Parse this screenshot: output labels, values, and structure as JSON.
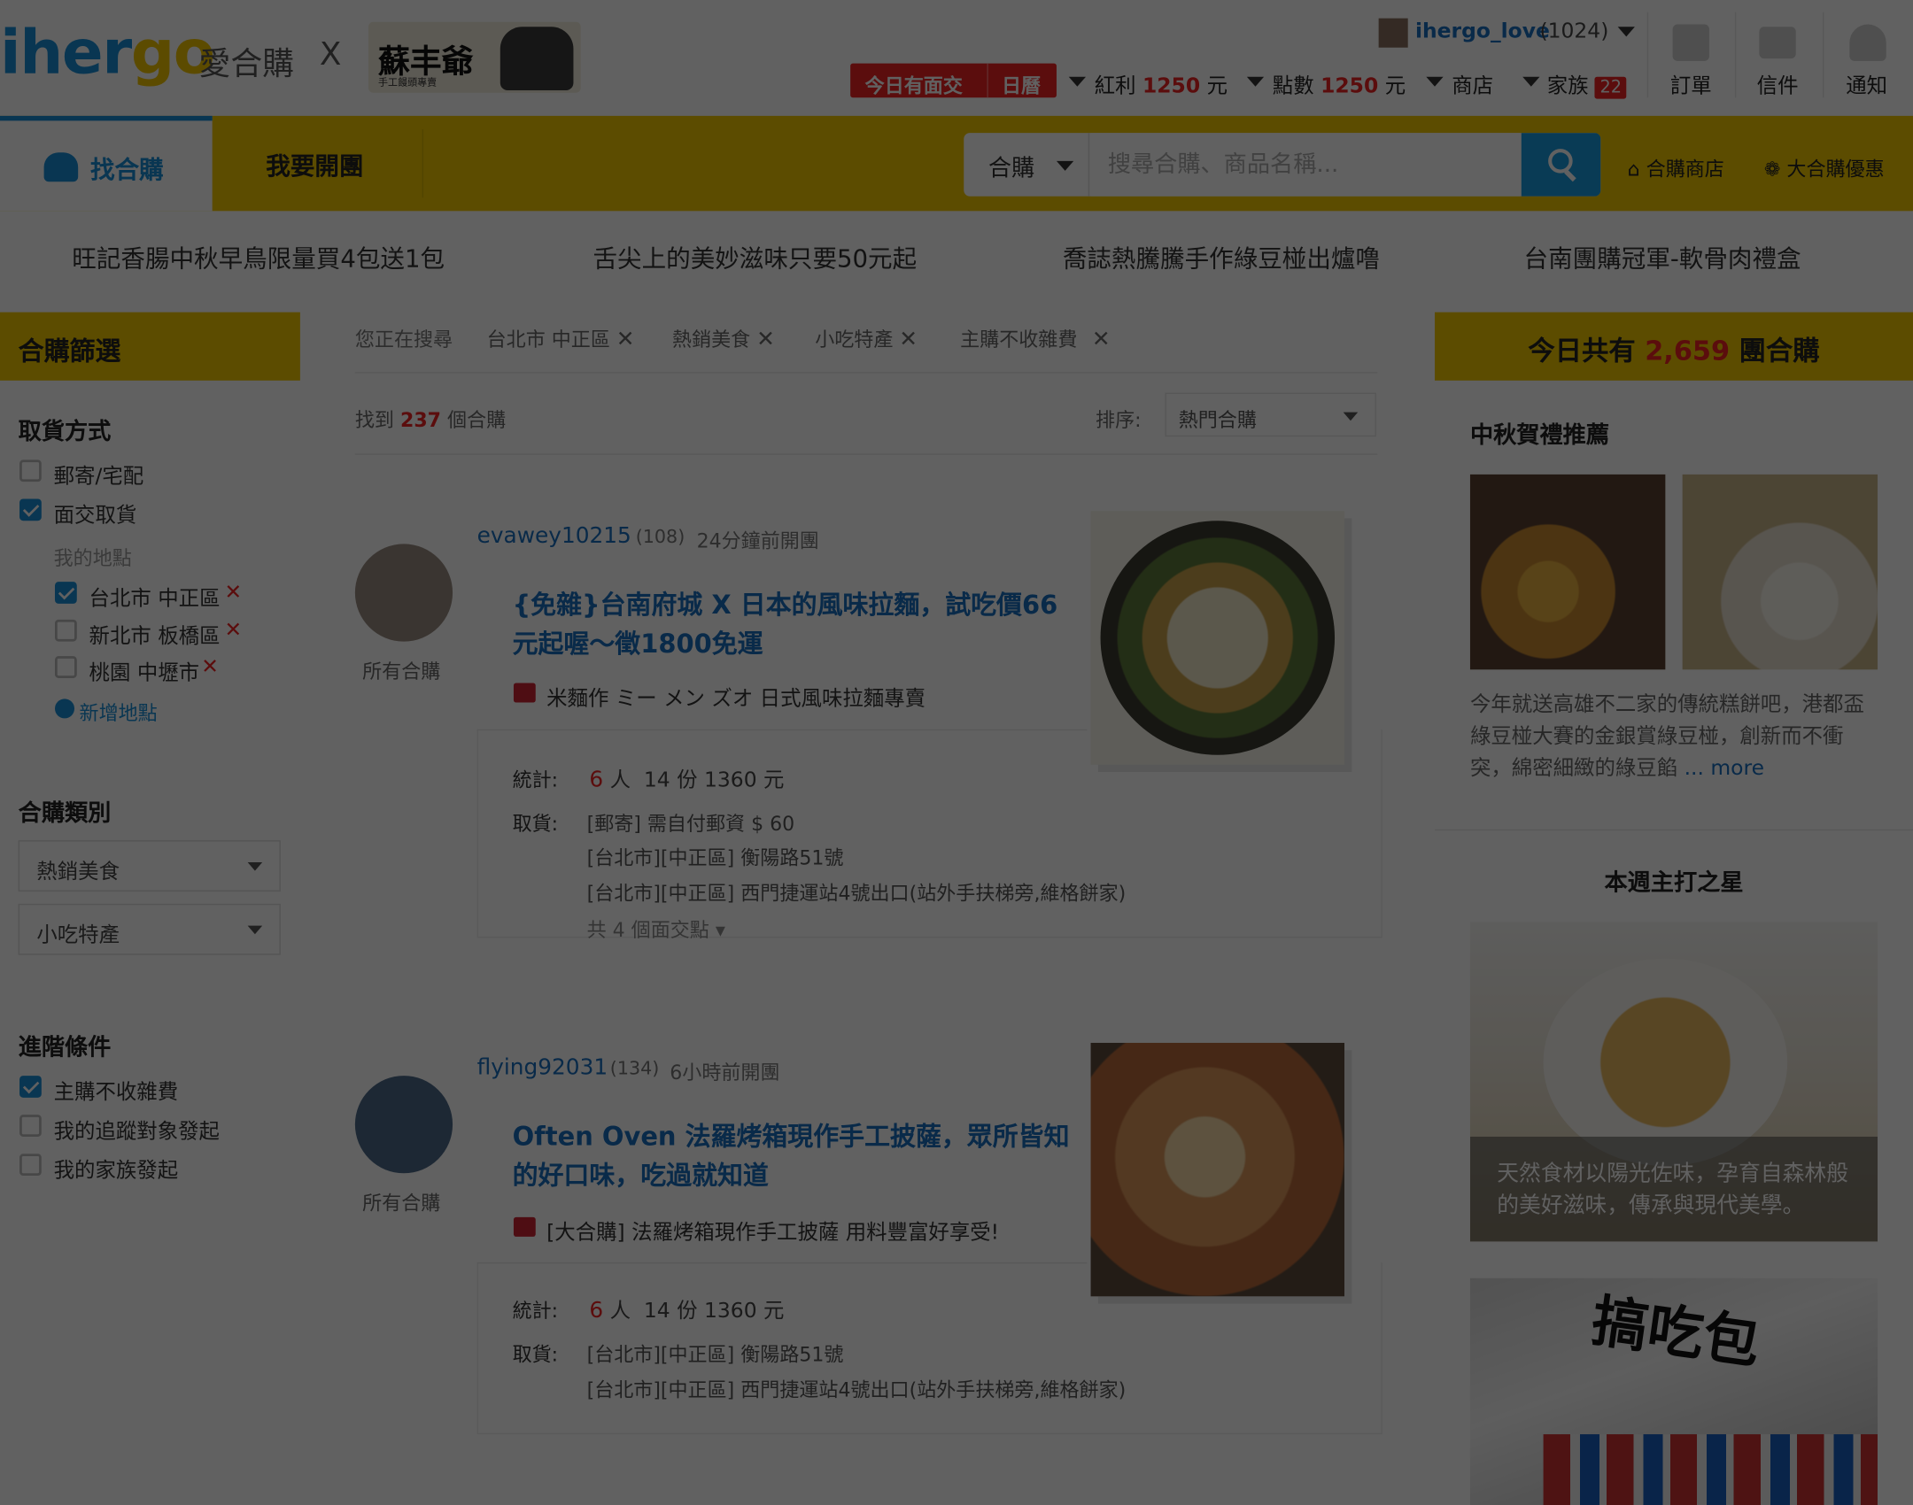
{
  "header": {
    "logo_main": "iher",
    "logo_accent": "go",
    "logo_sub": "愛合購",
    "logo_x": "X",
    "partner_name": "蘇丰爺",
    "partner_sub": "手工饅頭專賣",
    "user_name": "ihergo_love",
    "user_count": "(1024)",
    "today_btn_a": "今日有面交",
    "today_btn_b": "日曆",
    "bonus_label": "紅利",
    "bonus_value": "1250",
    "bonus_unit": "元",
    "points_label": "點數",
    "points_value": "1250",
    "points_unit": "元",
    "shop_label": "商店",
    "family_label": "家族",
    "family_badge": "22",
    "orders_label": "訂單",
    "mail_label": "信件",
    "notify_label": "通知"
  },
  "nav": {
    "tab_find": "找合購",
    "tab_open": "我要開團",
    "search_type": "合購",
    "search_placeholder": "搜尋合購、商品名稱...",
    "link_stores": "合購商店",
    "link_deals": "大合購優惠"
  },
  "banners": [
    "旺記香腸中秋早鳥限量買4包送1包",
    "舌尖上的美妙滋味只要50元起",
    "喬誌熱騰騰手作綠豆椪出爐噜",
    "台南團購冠軍-軟骨肉禮盒"
  ],
  "filters": {
    "title": "合購篩選",
    "pickup_title": "取貨方式",
    "pickup_options": [
      {
        "label": "郵寄/宅配",
        "checked": false
      },
      {
        "label": "面交取貨",
        "checked": true
      }
    ],
    "my_locations_label": "我的地點",
    "locations": [
      {
        "label": "台北市 中正區",
        "checked": true
      },
      {
        "label": "新北市 板橋區",
        "checked": false
      },
      {
        "label": "桃園 中壢市",
        "checked": false
      }
    ],
    "remove_mark": "✕",
    "add_location": "新增地點",
    "category_title": "合購類別",
    "category_1": "熱銷美食",
    "category_2": "小吃特產",
    "advanced_title": "進階條件",
    "advanced_options": [
      {
        "label": "主購不收雜費",
        "checked": true
      },
      {
        "label": "我的追蹤對象發起",
        "checked": false
      },
      {
        "label": "我的家族發起",
        "checked": false
      }
    ]
  },
  "results": {
    "searching_label": "您正在搜尋",
    "chips": [
      "台北市 中正區",
      "熱銷美食",
      "小吃特產",
      "主購不收雜費"
    ],
    "chip_remove": "✕",
    "found_prefix": "找到",
    "found_count": "237",
    "found_suffix": "個合購",
    "sort_label": "排序:",
    "sort_value": "熱門合購"
  },
  "cards": [
    {
      "poster": "evawey10215",
      "poster_count": "(108)",
      "time": "24分鐘前開團",
      "all_link": "所有合購",
      "title": "{免雜}台南府城 X 日本的風味拉麵，試吃價66元起喔～徵1800免運",
      "store": "米麵作 ミー メン ズオ 日式風味拉麵專賣",
      "stat_label": "統計:",
      "stat_people": "6",
      "stat_people_unit": "人",
      "stat_rest": "14 份 1360 元",
      "pickup_label": "取貨:",
      "pickup_lines": [
        "[郵寄] 需自付郵資 $ 60",
        "[台北市][中正區] 衡陽路51號",
        "[台北市][中正區] 西門捷運站4號出口(站外手扶梯旁,維格餅家)"
      ],
      "more": "共 4 個面交點"
    },
    {
      "poster": "flying92031",
      "poster_count": "(134)",
      "time": "6小時前開團",
      "all_link": "所有合購",
      "title": "Often Oven 法羅烤箱現作手工披薩，眾所皆知的好口味，吃過就知道",
      "store": "[大合購] 法羅烤箱現作手工披薩 用料豐富好享受!",
      "stat_label": "統計:",
      "stat_people": "6",
      "stat_people_unit": "人",
      "stat_rest": "14 份 1360 元",
      "pickup_label": "取貨:",
      "pickup_lines": [
        "[台北市][中正區] 衡陽路51號",
        "[台北市][中正區] 西門捷運站4號出口(站外手扶梯旁,維格餅家)"
      ]
    }
  ],
  "right": {
    "today_prefix": "今日共有",
    "today_count": "2,659",
    "today_suffix": "團合購",
    "gift_title": "中秋賀禮推薦",
    "gift_desc": "今年就送高雄不二家的傳統糕餅吧，港都盃綠豆椪大賽的金銀賞綠豆椪，創新而不衝突，綿密細緻的綠豆餡",
    "gift_more": "... more",
    "star_title": "本週主打之星",
    "star_caption": "天然食材以陽光佐味，孕育自森林般的美好滋味，傳承與現代美學。",
    "store_sign": "搞吃包"
  },
  "colors": {
    "accent_yellow": "#f2c900",
    "link_blue": "#1a6fbf",
    "search_blue": "#1a9be0",
    "alert_red": "#e22"
  }
}
